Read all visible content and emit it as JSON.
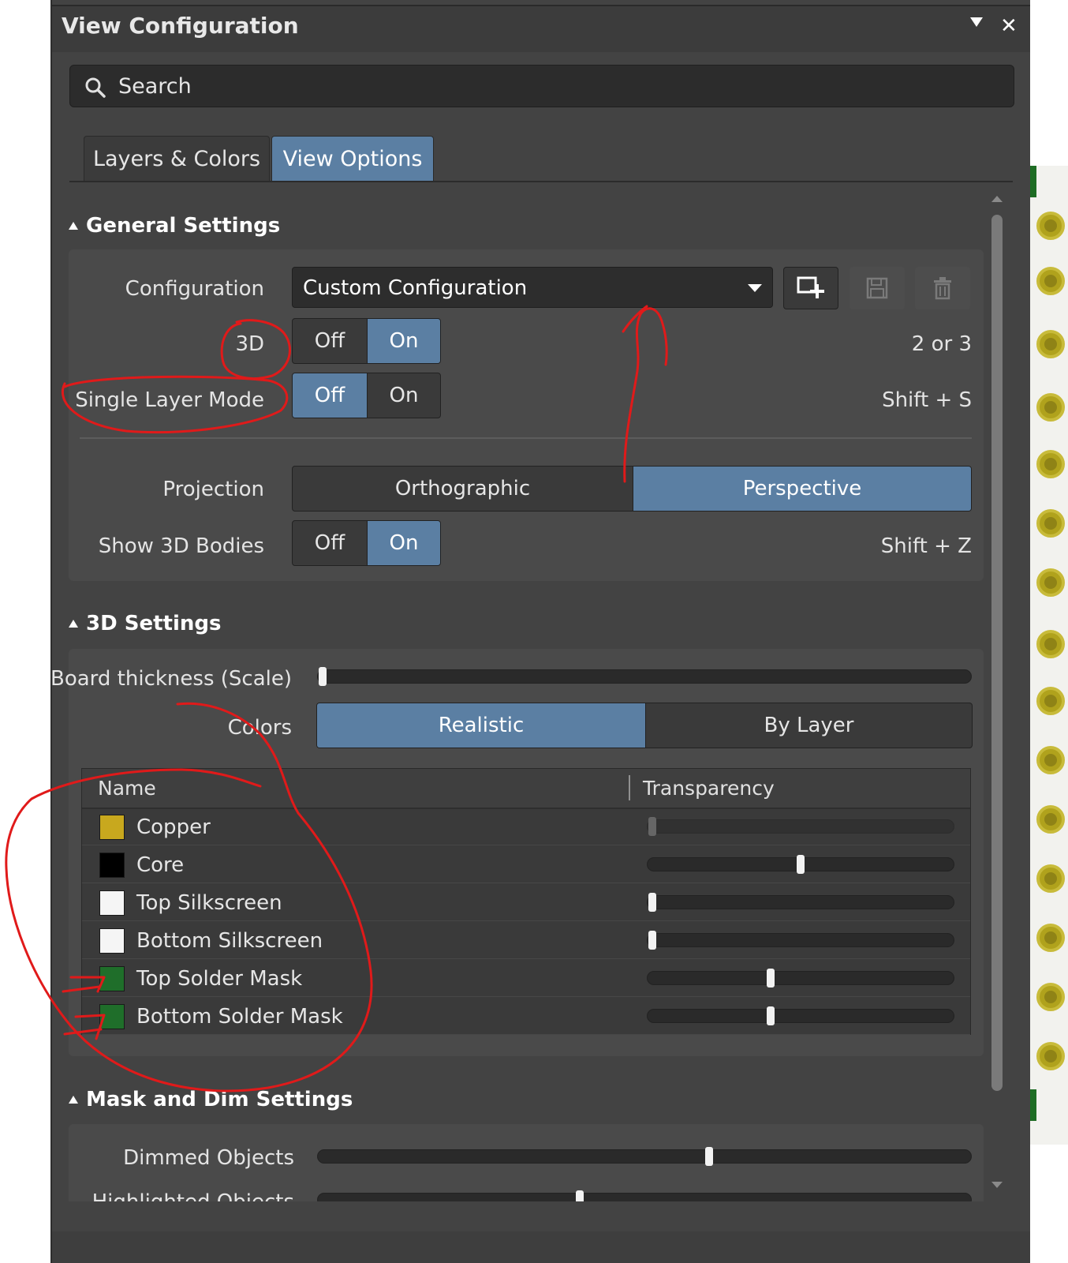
{
  "window": {
    "title": "View Configuration"
  },
  "search": {
    "placeholder": "Search"
  },
  "tabs": [
    {
      "label": "Layers & Colors",
      "active": false
    },
    {
      "label": "View Options",
      "active": true
    }
  ],
  "general_settings": {
    "title": "General Settings",
    "configuration": {
      "label": "Configuration",
      "value": "Custom Configuration"
    },
    "toggles": [
      {
        "label": "3D",
        "off": "Off",
        "on": "On",
        "selected": "On",
        "hotkey": "2 or 3"
      },
      {
        "label": "Single Layer Mode",
        "off": "Off",
        "on": "On",
        "selected": "Off",
        "hotkey": "Shift + S"
      }
    ],
    "projection": {
      "label": "Projection",
      "options": [
        "Orthographic",
        "Perspective"
      ],
      "selected": "Perspective"
    },
    "show_3d_bodies": {
      "label": "Show 3D Bodies",
      "off": "Off",
      "on": "On",
      "selected": "On",
      "hotkey": "Shift + Z"
    }
  },
  "settings_3d": {
    "title": "3D Settings",
    "board_thickness": {
      "label": "Board thickness (Scale)",
      "value": 0.0
    },
    "colors": {
      "label": "Colors",
      "options": [
        "Realistic",
        "By Layer"
      ],
      "selected": "Realistic"
    },
    "table": {
      "columns": [
        "Name",
        "Transparency"
      ],
      "rows": [
        {
          "name": "Copper",
          "color": "#c8a81e",
          "transparency": 0.0
        },
        {
          "name": "Core",
          "color": "#000000",
          "transparency": 0.5
        },
        {
          "name": "Top Silkscreen",
          "color": "#f5f5f5",
          "transparency": 0.0
        },
        {
          "name": "Bottom Silkscreen",
          "color": "#f5f5f5",
          "transparency": 0.0
        },
        {
          "name": "Top Solder Mask",
          "color": "#1f6e2a",
          "transparency": 0.4
        },
        {
          "name": "Bottom Solder Mask",
          "color": "#1f6e2a",
          "transparency": 0.4
        }
      ]
    }
  },
  "mask_dim_settings": {
    "title": "Mask and Dim Settings",
    "dimmed_objects": {
      "label": "Dimmed Objects",
      "value": 0.6
    },
    "highlighted_objects": {
      "label": "Highlighted Objects",
      "value": 0.4
    }
  },
  "colors": {
    "accent": "#5b7fa3",
    "panel": "#434343",
    "annotation": "#e01a1a"
  }
}
